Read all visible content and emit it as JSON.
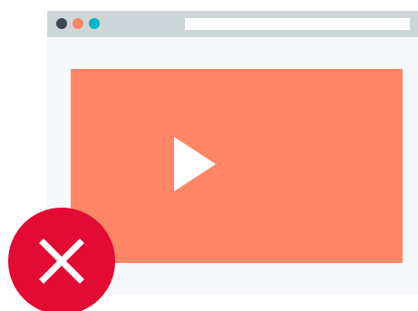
{
  "window": {
    "traffic_lights": [
      {
        "name": "close-dot",
        "color": "#3d4a55"
      },
      {
        "name": "minimize-dot",
        "color": "#ff8567"
      },
      {
        "name": "maximize-dot",
        "color": "#00b5c8"
      }
    ],
    "address_bar_value": ""
  },
  "video": {
    "background_color": "#ff8567",
    "play_icon": "play-icon"
  },
  "error_badge": {
    "color": "#e30a33",
    "icon": "close-x-icon"
  }
}
